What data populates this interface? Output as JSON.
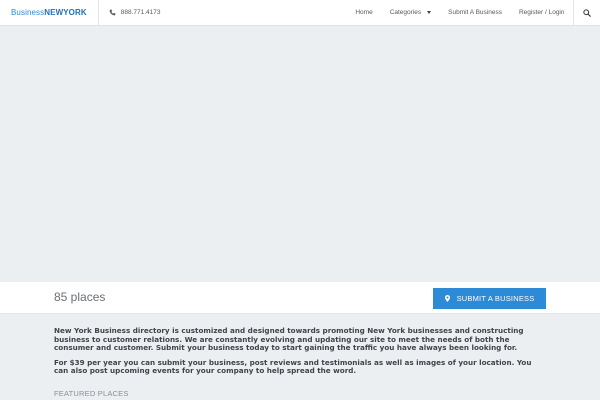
{
  "header": {
    "logo_part1": "Business",
    "logo_part2": "NEWYORK",
    "phone": "888.771.4173",
    "nav": {
      "home": "Home",
      "categories": "Categories",
      "submit": "Submit A Business",
      "register": "Register / Login"
    }
  },
  "places": {
    "count_label": "85 places",
    "cta_label": "SUBMIT A BUSINESS"
  },
  "content": {
    "paragraph1": "New York Business directory is customized and designed towards promoting New York businesses and constructing business to customer relations. We are constantly evolving and updating our site to meet the needs of both the consumer and customer. Submit your business today to start gaining the traffic you have always been looking for.",
    "paragraph2": "For $39 per year you can submit your business, post reviews and testimonials as well as images of your location. You can also post upcoming events for your company to help spread the word.",
    "featured_heading": "FEATURED PLACES"
  },
  "colors": {
    "accent": "#2d8ad6",
    "map_background": "#eceff1"
  },
  "icons": {
    "phone": "phone-icon",
    "categories_caret": "chevron-down-icon",
    "search": "search-icon",
    "cta": "map-pin-icon"
  }
}
